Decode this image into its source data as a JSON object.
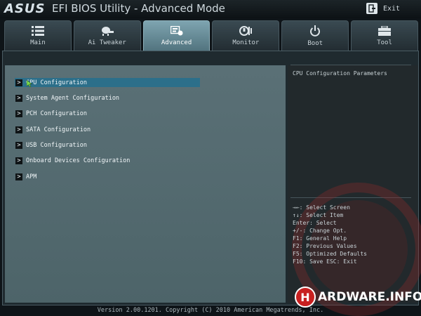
{
  "header": {
    "logo": "ASUS",
    "title": "EFI BIOS Utility - Advanced Mode",
    "exit_label": "Exit"
  },
  "tabs": [
    {
      "label": "Main",
      "icon": "list-icon"
    },
    {
      "label": "Ai Tweaker",
      "icon": "tweaker-icon"
    },
    {
      "label": "Advanced",
      "icon": "advanced-icon",
      "active": true
    },
    {
      "label": "Monitor",
      "icon": "monitor-icon"
    },
    {
      "label": "Boot",
      "icon": "power-icon"
    },
    {
      "label": "Tool",
      "icon": "toolbox-icon"
    }
  ],
  "menu": {
    "items": [
      {
        "label": "CPU Configuration",
        "selected": true
      },
      {
        "label": "System Agent Configuration"
      },
      {
        "label": "PCH Configuration"
      },
      {
        "label": "SATA Configuration"
      },
      {
        "label": "USB Configuration"
      },
      {
        "label": "Onboard Devices Configuration"
      },
      {
        "label": "APM"
      }
    ]
  },
  "help": {
    "description": "CPU Configuration Parameters",
    "keys": [
      "→←: Select Screen",
      "↑↓: Select Item",
      "Enter: Select",
      "+/-: Change Opt.",
      "F1: General Help",
      "F2: Previous Values",
      "F5: Optimized Defaults",
      "F10: Save  ESC: Exit"
    ]
  },
  "footer": {
    "copyright": "Version 2.00.1201. Copyright (C) 2010 American Megatrends, Inc."
  },
  "watermark": {
    "h": "H",
    "text": "ARDWARE.INFO"
  },
  "colors": {
    "accent": "#2c6f8a",
    "active_tab": "#6f95a1",
    "panel": "#566c72"
  }
}
